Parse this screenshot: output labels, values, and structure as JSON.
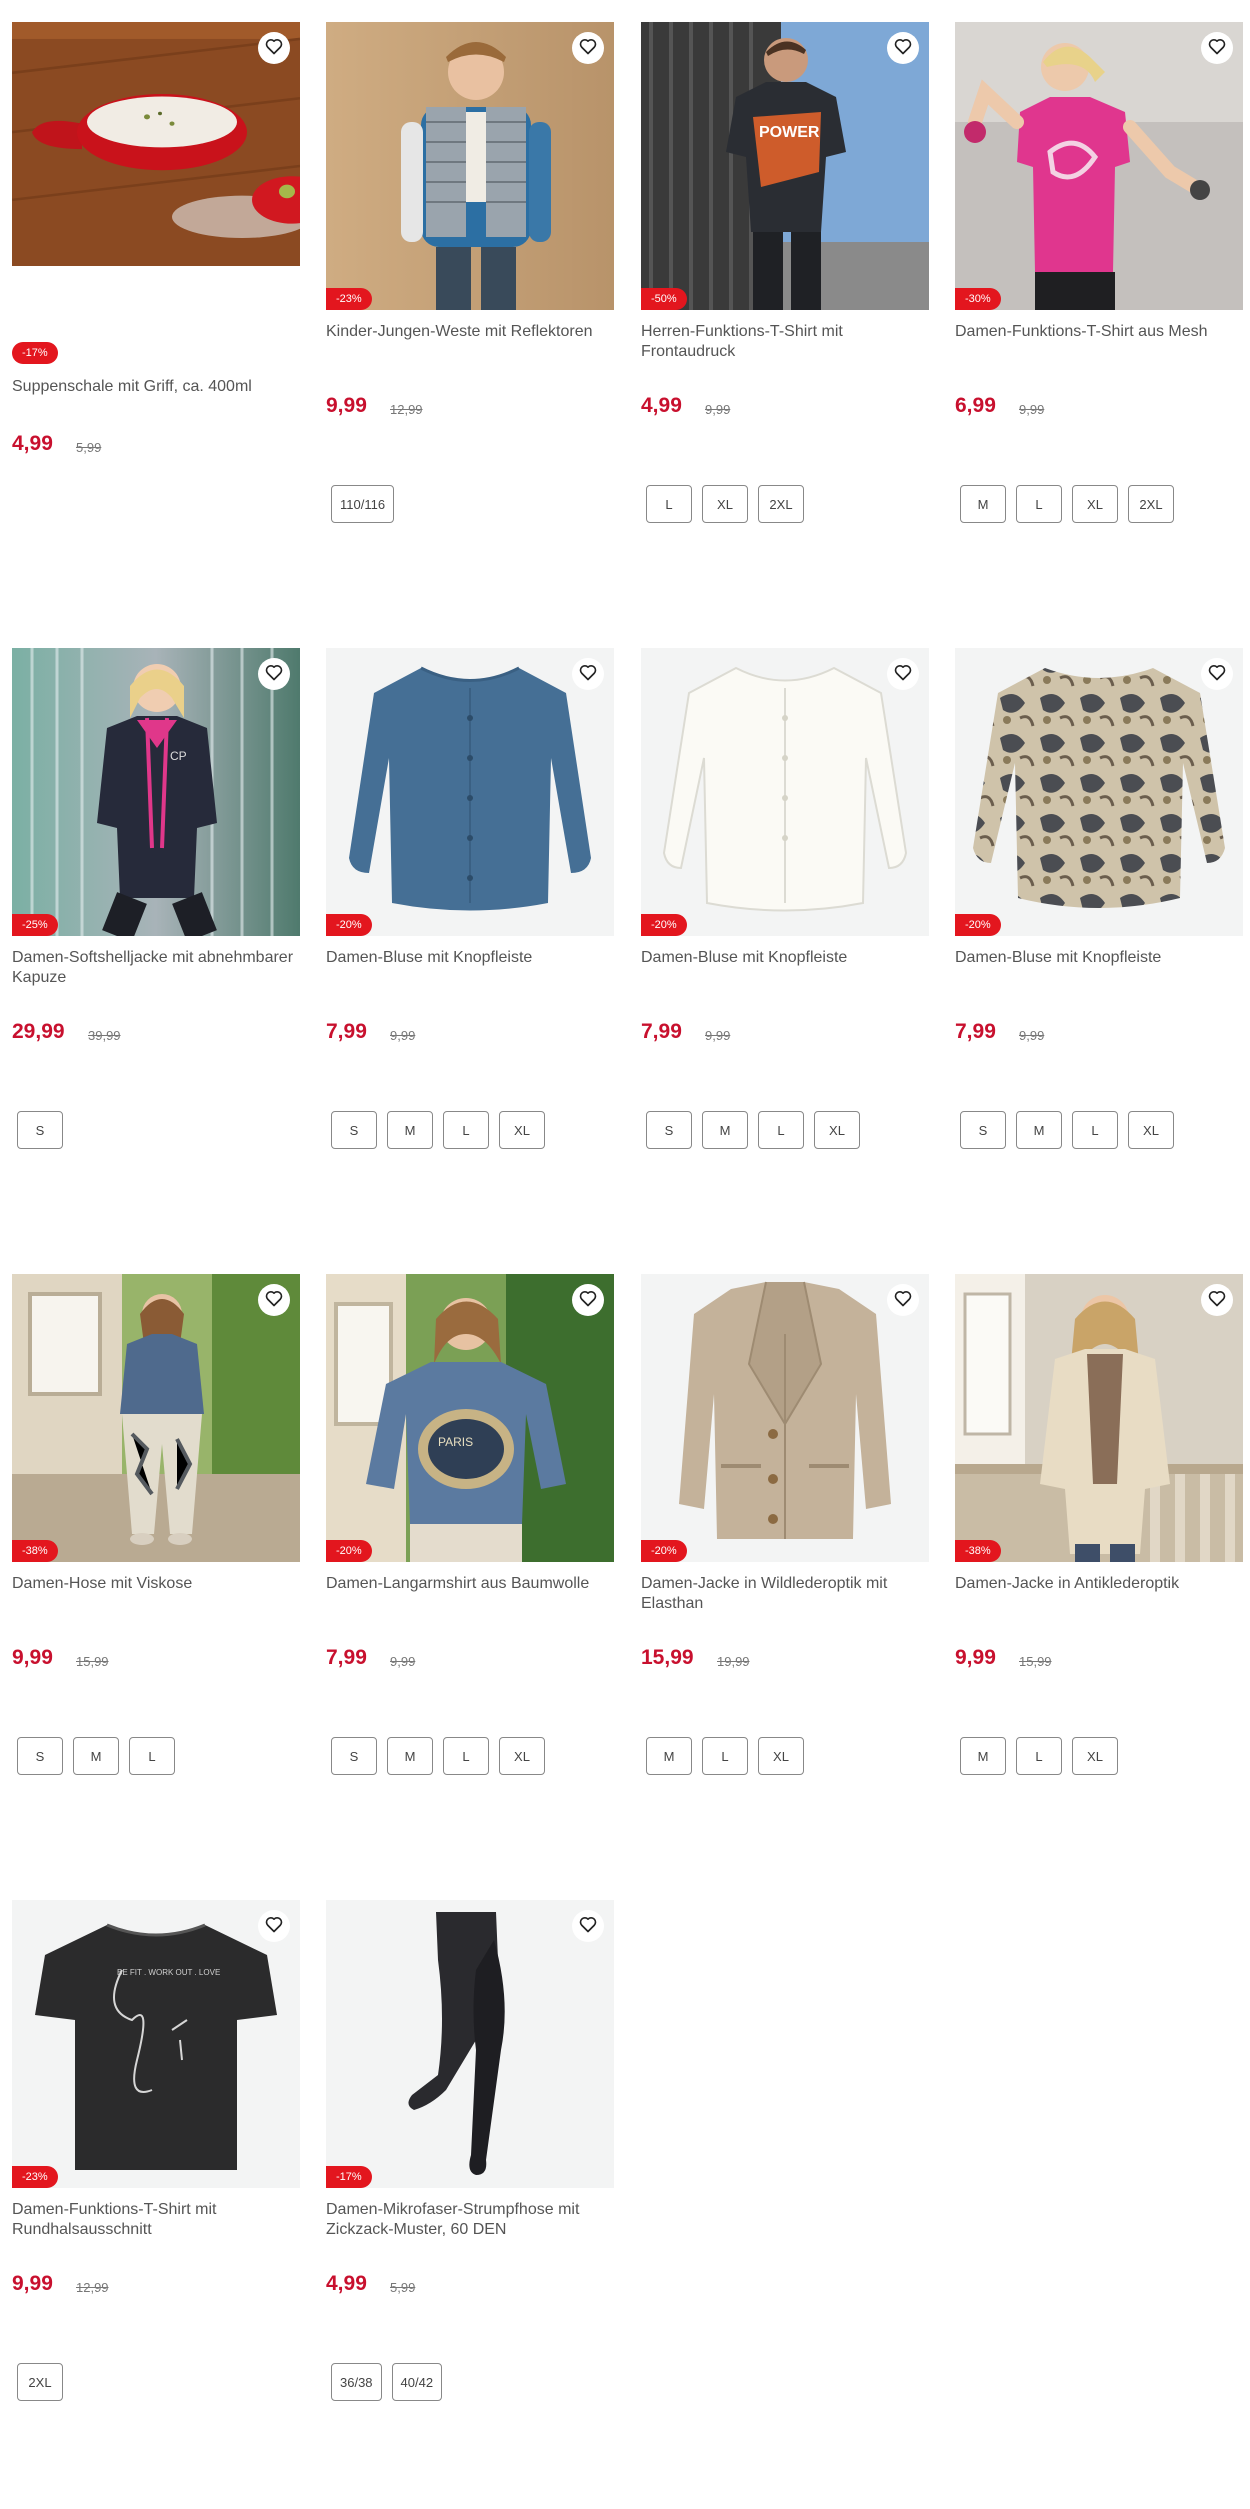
{
  "products": [
    {
      "title": "Suppenschale mit Griff, ca. 400ml",
      "price": "4,99",
      "old_price": "5,99",
      "discount": "-17%",
      "sizes": [],
      "image": "soup-bowl",
      "favorite_icon": "heart-outline-icon"
    },
    {
      "title": "Kinder-Jungen-Weste mit Reflektoren",
      "price": "9,99",
      "old_price": "12,99",
      "discount": "-23%",
      "sizes": [
        "110/116"
      ],
      "image": "boy-vest",
      "favorite_icon": "heart-outline-icon"
    },
    {
      "title": "Herren-Funktions-T-Shirt mit Frontaudruck",
      "price": "4,99",
      "old_price": "9,99",
      "discount": "-50%",
      "sizes": [
        "L",
        "XL",
        "2XL"
      ],
      "image": "man-shirt",
      "favorite_icon": "heart-outline-icon"
    },
    {
      "title": "Damen-Funktions-T-Shirt aus Mesh",
      "price": "6,99",
      "old_price": "9,99",
      "discount": "-30%",
      "sizes": [
        "M",
        "L",
        "XL",
        "2XL"
      ],
      "image": "pink-shirt",
      "favorite_icon": "heart-outline-icon"
    },
    {
      "title": "Damen-Softshelljacke mit abnehmbarer Kapuze",
      "price": "29,99",
      "old_price": "39,99",
      "discount": "-25%",
      "sizes": [
        "S"
      ],
      "image": "softshell",
      "favorite_icon": "heart-outline-icon"
    },
    {
      "title": "Damen-Bluse mit Knopfleiste",
      "price": "7,99",
      "old_price": "9,99",
      "discount": "-20%",
      "sizes": [
        "S",
        "M",
        "L",
        "XL"
      ],
      "image": "blue-blouse",
      "favorite_icon": "heart-outline-icon"
    },
    {
      "title": "Damen-Bluse mit Knopfleiste",
      "price": "7,99",
      "old_price": "9,99",
      "discount": "-20%",
      "sizes": [
        "S",
        "M",
        "L",
        "XL"
      ],
      "image": "white-blouse",
      "favorite_icon": "heart-outline-icon"
    },
    {
      "title": "Damen-Bluse mit Knopfleiste",
      "price": "7,99",
      "old_price": "9,99",
      "discount": "-20%",
      "sizes": [
        "S",
        "M",
        "L",
        "XL"
      ],
      "image": "print-blouse",
      "favorite_icon": "heart-outline-icon"
    },
    {
      "title": "Damen-Hose mit Viskose",
      "price": "9,99",
      "old_price": "15,99",
      "discount": "-38%",
      "sizes": [
        "S",
        "M",
        "L"
      ],
      "image": "woman-pants",
      "favorite_icon": "heart-outline-icon"
    },
    {
      "title": "Damen-Langarmshirt aus Baumwolle",
      "price": "7,99",
      "old_price": "9,99",
      "discount": "-20%",
      "sizes": [
        "S",
        "M",
        "L",
        "XL"
      ],
      "image": "woman-longsleeve",
      "favorite_icon": "heart-outline-icon"
    },
    {
      "title": "Damen-Jacke in Wildlederoptik mit Elasthan",
      "price": "15,99",
      "old_price": "19,99",
      "discount": "-20%",
      "sizes": [
        "M",
        "L",
        "XL"
      ],
      "image": "suede-jacket",
      "favorite_icon": "heart-outline-icon"
    },
    {
      "title": "Damen-Jacke in Antiklederoptik",
      "price": "9,99",
      "old_price": "15,99",
      "discount": "-38%",
      "sizes": [
        "M",
        "L",
        "XL"
      ],
      "image": "antique-jacket",
      "favorite_icon": "heart-outline-icon"
    },
    {
      "title": "Damen-Funktions-T-Shirt mit Rundhalsausschnitt",
      "price": "9,99",
      "old_price": "12,99",
      "discount": "-23%",
      "sizes": [
        "2XL"
      ],
      "image": "black-shirt",
      "favorite_icon": "heart-outline-icon"
    },
    {
      "title": "Damen-Mikrofaser-Strumpfhose mit Zickzack-Muster, 60 DEN",
      "price": "4,99",
      "old_price": "5,99",
      "discount": "-17%",
      "sizes": [
        "36/38",
        "40/42"
      ],
      "image": "tights",
      "favorite_icon": "heart-outline-icon"
    }
  ],
  "colors": {
    "accent": "#c8102e",
    "badge": "#e3161e",
    "image_bg": "#f3f4f4"
  }
}
